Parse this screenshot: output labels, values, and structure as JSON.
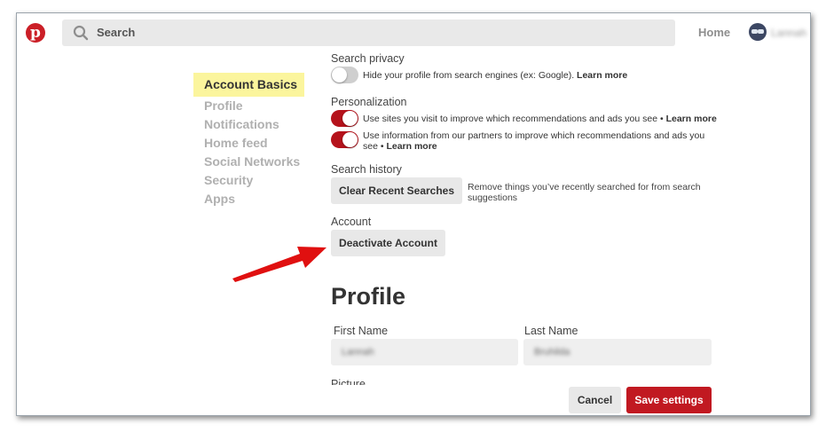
{
  "header": {
    "logo_icon": "pinterest-logo",
    "search_placeholder": "Search",
    "home_label": "Home",
    "username": "Lannah"
  },
  "sidebar": {
    "items": [
      {
        "label": "Account Basics",
        "active": true
      },
      {
        "label": "Profile"
      },
      {
        "label": "Notifications"
      },
      {
        "label": "Home feed"
      },
      {
        "label": "Social Networks"
      },
      {
        "label": "Security"
      },
      {
        "label": "Apps"
      }
    ]
  },
  "search_privacy": {
    "label": "Search privacy",
    "toggle_on": false,
    "text": "Hide your profile from search engines (ex: Google).",
    "learn_more": "Learn more"
  },
  "personalization": {
    "label": "Personalization",
    "options": [
      {
        "toggle_on": true,
        "text": "Use sites you visit to improve which recommendations and ads you see •",
        "learn_more": "Learn more"
      },
      {
        "toggle_on": true,
        "text": "Use information from our partners to improve which recommendations and ads you see •",
        "learn_more": "Learn more"
      }
    ]
  },
  "search_history": {
    "label": "Search history",
    "button": "Clear Recent Searches",
    "hint": "Remove things you’ve recently searched for from search suggestions"
  },
  "account": {
    "label": "Account",
    "button": "Deactivate Account"
  },
  "profile": {
    "heading": "Profile",
    "first_name_label": "First Name",
    "first_name_value": "Lannah",
    "last_name_label": "Last Name",
    "last_name_value": "Bruhilda",
    "picture_label": "Picture"
  },
  "footer": {
    "cancel": "Cancel",
    "save": "Save settings"
  },
  "colors": {
    "brand_red": "#c11921",
    "highlight": "#fbf59d",
    "annotation_arrow": "#e01010"
  }
}
